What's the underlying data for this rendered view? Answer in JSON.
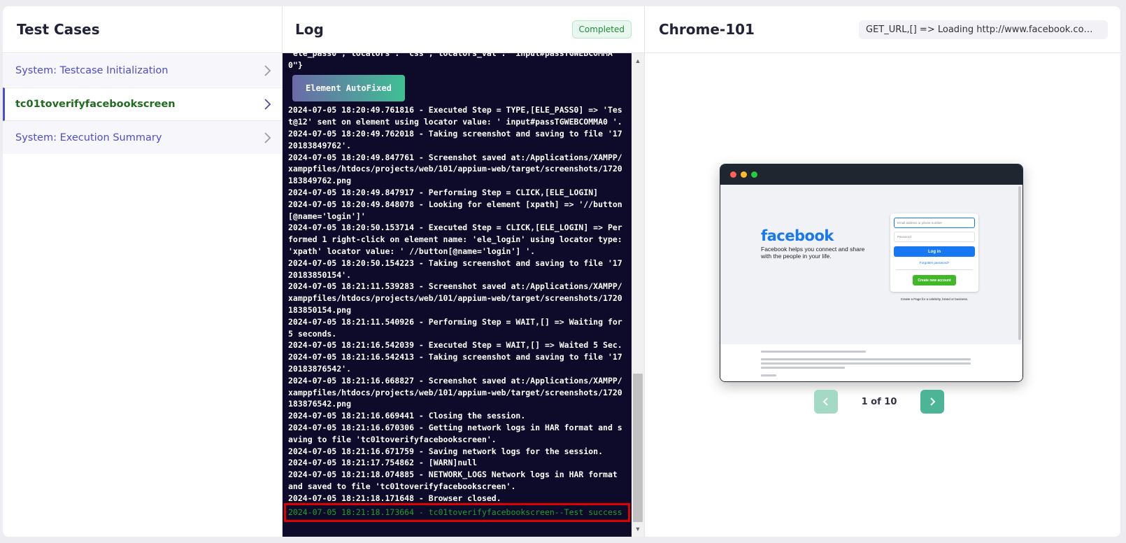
{
  "test_cases": {
    "title": "Test Cases",
    "items": [
      {
        "label": "System: Testcase Initialization"
      },
      {
        "label": "tc01toverifyfacebookscreen"
      },
      {
        "label": "System: Execution Summary"
      }
    ]
  },
  "log": {
    "title": "Log",
    "status": "Completed",
    "truncated_top": "\"ele_pass0\",\"locators\": \"css\",\"locators_val\": \"input#passTGWEBCOMMA0\"}",
    "autofix_label": "Element AutoFixed",
    "lines": [
      "2024-07-05 18:20:49.761816 - Executed Step = TYPE,[ELE_PASS0] => 'Test@12' sent on element using locator value: ' input#passTGWEBCOMMA0 '.",
      "2024-07-05 18:20:49.762018 - Taking screenshot and saving to file '1720183849762'.",
      "2024-07-05 18:20:49.847761 - Screenshot saved at:/Applications/XAMPP/xamppfiles/htdocs/projects/web/101/appium-web/target/screenshots/1720183849762.png",
      "2024-07-05 18:20:49.847917 - Performing Step = CLICK,[ELE_LOGIN]",
      "2024-07-05 18:20:49.848078 - Looking for element [xpath] => '//button[@name='login']'",
      "2024-07-05 18:20:50.153714 - Executed Step = CLICK,[ELE_LOGIN] => Performed 1 right-click on element name: 'ele_login' using locator type: 'xpath' locator value: ' //button[@name='login'] '.",
      "2024-07-05 18:20:50.154223 - Taking screenshot and saving to file '1720183850154'.",
      "2024-07-05 18:21:11.539283 - Screenshot saved at:/Applications/XAMPP/xamppfiles/htdocs/projects/web/101/appium-web/target/screenshots/1720183850154.png",
      "2024-07-05 18:21:11.540926 - Performing Step = WAIT,[] => Waiting for 5 seconds.",
      "2024-07-05 18:21:16.542039 - Executed Step = WAIT,[] => Waited 5 Sec.",
      "2024-07-05 18:21:16.542413 - Taking screenshot and saving to file '1720183876542'.",
      "2024-07-05 18:21:16.668827 - Screenshot saved at:/Applications/XAMPP/xamppfiles/htdocs/projects/web/101/appium-web/target/screenshots/1720183876542.png",
      "2024-07-05 18:21:16.669441 - Closing the session.",
      "2024-07-05 18:21:16.670306 - Getting network logs in HAR format and saving to file 'tc01toverifyfacebookscreen'.",
      "2024-07-05 18:21:16.671759 - Saving network logs for the session.",
      "2024-07-05 18:21:17.754862 - [WARN]null",
      "2024-07-05 18:21:18.074885 - NETWORK_LOGS Network logs in HAR format and saved to file 'tc01toverifyfacebookscreen'.",
      "2024-07-05 18:21:18.171648 - Browser closed."
    ],
    "success_line": "2024-07-05 18:21:18.173664 - tc01toverifyfacebookscreen--Test success",
    "colors": {
      "success": "#1d9d2f",
      "highlight": "#e00000",
      "background": "#0e0b2a"
    }
  },
  "browser": {
    "title": "Chrome-101",
    "url_status": "GET_URL,[] => Loading http://www.facebook.com/ on browser",
    "screenshot": {
      "logo": "facebook",
      "tagline": "Facebook helps you connect and share with the people in your life.",
      "email_placeholder": "Email address or phone number",
      "password_placeholder": "Password",
      "login_label": "Log in",
      "forgot_label": "Forgotten password?",
      "create_label": "Create new account",
      "page_link": "Create a Page for a celebrity, brand or business."
    },
    "pager": {
      "label": "1 of 10",
      "current": 1,
      "total": 10
    }
  }
}
